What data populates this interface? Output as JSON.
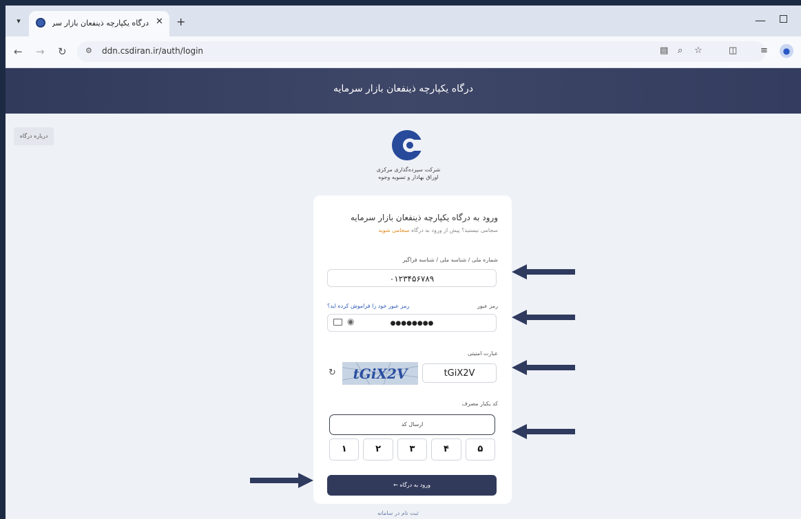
{
  "browser": {
    "tab_title": "درگاه یکپارچه ذینفعان بازار سرمایه",
    "url": "ddn.csdiran.ir/auth/login"
  },
  "header": {
    "title": "درگاه یکپارچه ذینفعان بازار سرمایه"
  },
  "about_button": "درباره درگاه",
  "logo": {
    "line1": "شرکت سپرده‌گذاری مرکزی",
    "line2": "اوراق بهادار و تسویه وجوه"
  },
  "login": {
    "title": "ورود به درگاه یکپارچه ذینفعان بازار سرمایه",
    "subtitle": "سجامی نیستید؟ پیش از ورود به درگاه",
    "register_link": "سجامی شوید",
    "national_id_label": "شماره ملی / شناسه ملی / شناسه فراگیر",
    "national_id_value": "۰۱۲۳۴۵۶۷۸۹",
    "password_label": "رمز عبور",
    "forgot_password": "رمز عبور خود را فراموش کرده اید؟",
    "password_value": "●●●●●●●●",
    "captcha_label": "عبارت امنیتی",
    "captcha_image_text": "tGiX2V",
    "captcha_value": "tGiX2V",
    "otp_label": "کد یکبار مصرف",
    "send_code_button": "ارسال کد",
    "otp_digits": [
      "۱",
      "۲",
      "۳",
      "۴",
      "۵"
    ],
    "submit_button": "ورود به درگاه"
  },
  "footer": {
    "link": "ثبت نام در سامانه"
  },
  "colors": {
    "header": "#323a5c",
    "annotation_arrow": "#2e3a5e"
  }
}
